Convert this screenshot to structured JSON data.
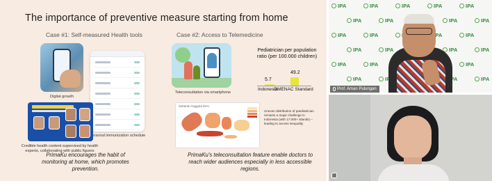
{
  "slide": {
    "title": "The importance of preventive measure starting from home",
    "case1": {
      "label": "Case #1: Self-measured Health tools",
      "caption_digital": "Digital growth",
      "caption_immunization": "Personal immunization schedule",
      "caption_credible": "Credible health content supervised by health experts, collaborating with public figures",
      "quote": "PrimaKu encourages the habit of monitoring at home, which promotes prevention."
    },
    "case2": {
      "label": "Case #2: Access to Telemedicine",
      "caption_tele": "Teleconsultation via smartphone",
      "map_heading": "Sebaran Anggota IDAI",
      "map_note": "Uneven distribution of paediatrician remains a major challenge in Indonesia (with 17.000+ islands) – leading to access inequality",
      "quote": "PrimaKu's teleconsultation feature enable doctors to reach wider audiences especially in less accessible regions."
    },
    "colors": {
      "slide_bg": "#f8ebe1",
      "bar": "#e6e63a"
    }
  },
  "chart_data": {
    "type": "bar",
    "title": "Pediatrician per population ratio (per 100.000 children)",
    "categories": [
      "Indonesia",
      "GMENAC Standard"
    ],
    "values": [
      5.7,
      49.2
    ],
    "xlabel": "",
    "ylabel": ""
  },
  "video_tiles": [
    {
      "name_tag": "Prof. Aman Pulungan",
      "background_logo": "IPA",
      "mic": "mic-icon"
    },
    {
      "mic": "mic-muted-icon"
    }
  ]
}
